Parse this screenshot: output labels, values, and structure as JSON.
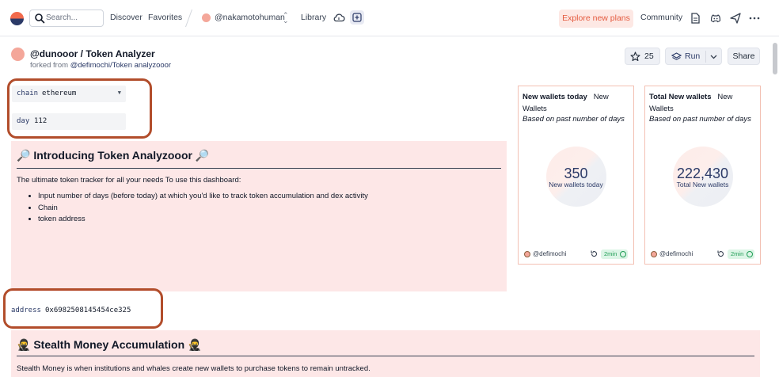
{
  "nav": {
    "search_placeholder": "Search...",
    "discover": "Discover",
    "favorites": "Favorites",
    "username": "@nakamotohuman",
    "library": "Library",
    "explore_plans": "Explore new plans",
    "community": "Community"
  },
  "header": {
    "title": "@dunooor / Token Analyzer",
    "forked_prefix": "forked from",
    "forked_source": "@defimochi/Token analyzooor",
    "star_count": "25",
    "run_label": "Run",
    "share_label": "Share"
  },
  "params": {
    "chain": {
      "key": "chain",
      "value": "ethereum"
    },
    "day": {
      "key": "day",
      "value": "112"
    },
    "address": {
      "key": "address",
      "value": "0x6982508145454ce325"
    }
  },
  "intro": {
    "heading": "🔎 Introducing Token Analyzooor 🔎",
    "body": "The ultimate token tracker for all your needs To use this dashboard:",
    "bullets": [
      "Input number of days (before today) at which you'd like to track token accumulation and dex activity",
      "Chain",
      "token address"
    ]
  },
  "stealth": {
    "heading": "🥷 Stealth Money Accumulation 🥷",
    "body": "Stealth Money is when institutions and whales create new wallets to purchase tokens to remain untracked."
  },
  "cards": [
    {
      "title_bold": "New wallets today",
      "title_rest": "New Wallets",
      "subtitle": "Based on past number of days",
      "value": "350",
      "value_label": "New wallets today",
      "author": "@defimochi",
      "age": "2min"
    },
    {
      "title_bold": "Total New wallets",
      "title_rest": "New Wallets",
      "subtitle": "Based on past number of days",
      "value": "222,430",
      "value_label": "Total New wallets",
      "author": "@defimochi",
      "age": "2min"
    }
  ],
  "colors": {
    "accent": "#2b3a67",
    "brand_orange": "#f16a4c",
    "panel_pink": "#fde7e7",
    "highlight_box": "#b24d2b",
    "success": "#1f9d55"
  },
  "icons": [
    "logo-icon",
    "search-icon",
    "chevron-updown-icon",
    "cloud-icon",
    "plus-icon",
    "document-icon",
    "discord-icon",
    "send-icon",
    "more-icon",
    "star-icon",
    "layers-icon",
    "chevron-down-icon",
    "caret-down-icon",
    "refresh-icon",
    "check-circle-icon"
  ]
}
